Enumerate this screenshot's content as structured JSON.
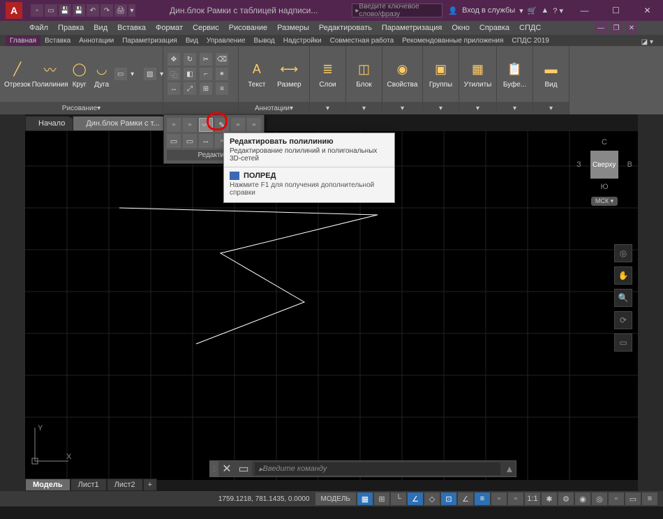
{
  "title": "Дин.блок Рамки с таблицей надписи...",
  "search_placeholder": "Введите ключевое слово/фразу",
  "signin": "Вход в службы",
  "menu": [
    "Файл",
    "Правка",
    "Вид",
    "Вставка",
    "Формат",
    "Сервис",
    "Рисование",
    "Размеры",
    "Редактировать",
    "Параметризация",
    "Окно",
    "Справка",
    "СПДС"
  ],
  "ribbon_tabs": [
    "Главная",
    "Вставка",
    "Аннотации",
    "Параметризация",
    "Вид",
    "Управление",
    "Вывод",
    "Надстройки",
    "Совместная работа",
    "Рекомендованные приложения",
    "СПДС 2019"
  ],
  "panels": {
    "draw": {
      "label": "Рисование",
      "items": {
        "line": "Отрезок",
        "pline": "Полилиния",
        "circle": "Круг",
        "arc": "Дуга"
      }
    },
    "ann": {
      "label": "Аннотации",
      "items": {
        "text": "Текст",
        "dim": "Размер"
      }
    },
    "layers": "Слои",
    "block": "Блок",
    "props": "Свойства",
    "groups": "Группы",
    "utils": "Утилиты",
    "clipboard": "Буфе...",
    "view": "Вид"
  },
  "edit_ext_label": "Редакти...",
  "tooltip": {
    "title": "Редактировать полилинию",
    "sub": "Редактирование полилиний и полигональных 3D-сетей",
    "cmd": "ПОЛРЕД",
    "help": "Нажмите F1 для получения дополнительной справки"
  },
  "doctabs": {
    "start": "Начало",
    "file": "Дин.блок Рамки с т..."
  },
  "navcube": {
    "n": "С",
    "s": "Ю",
    "w": "З",
    "e": "В",
    "top": "Сверху",
    "msk": "МСК"
  },
  "ucs": {
    "x": "X",
    "y": "Y"
  },
  "cmd_placeholder": "Введите команду",
  "model_tabs": [
    "Модель",
    "Лист1",
    "Лист2",
    "+"
  ],
  "status": {
    "coords": "1759.1218, 781.1435, 0.0000",
    "model": "МОДЕЛЬ"
  }
}
